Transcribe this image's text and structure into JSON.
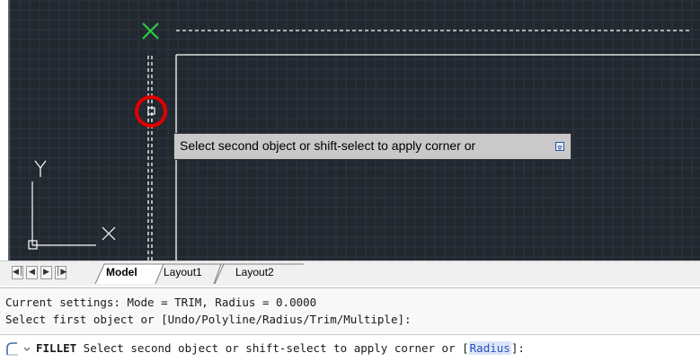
{
  "tooltip": {
    "text": "Select second object or shift-select to apply corner or"
  },
  "ucs": {
    "x_label": "X",
    "y_label": "Y"
  },
  "tabs": {
    "items": [
      {
        "label": "Model",
        "active": true
      },
      {
        "label": "Layout1",
        "active": false
      },
      {
        "label": "Layout2",
        "active": false
      }
    ]
  },
  "command_history": {
    "lines": [
      "Current settings: Mode = TRIM, Radius = 0.0000",
      "Select first object or [Undo/Polyline/Radius/Trim/Multiple]:"
    ]
  },
  "command_line": {
    "command": "FILLET",
    "prompt": " Select second object or shift-select to apply corner or [",
    "option": "Radius",
    "suffix": "]:"
  },
  "colors": {
    "canvas_background": "#212830",
    "cursor_marker": "#2ecc40",
    "highlight_circle": "#e00000",
    "geometry": "#ffffff"
  },
  "icons": {
    "cursor": "cross-marker-icon",
    "pickbox": "pickbox-icon",
    "command_icon": "command-line-icon",
    "dropdown": "chevron-down-icon"
  }
}
